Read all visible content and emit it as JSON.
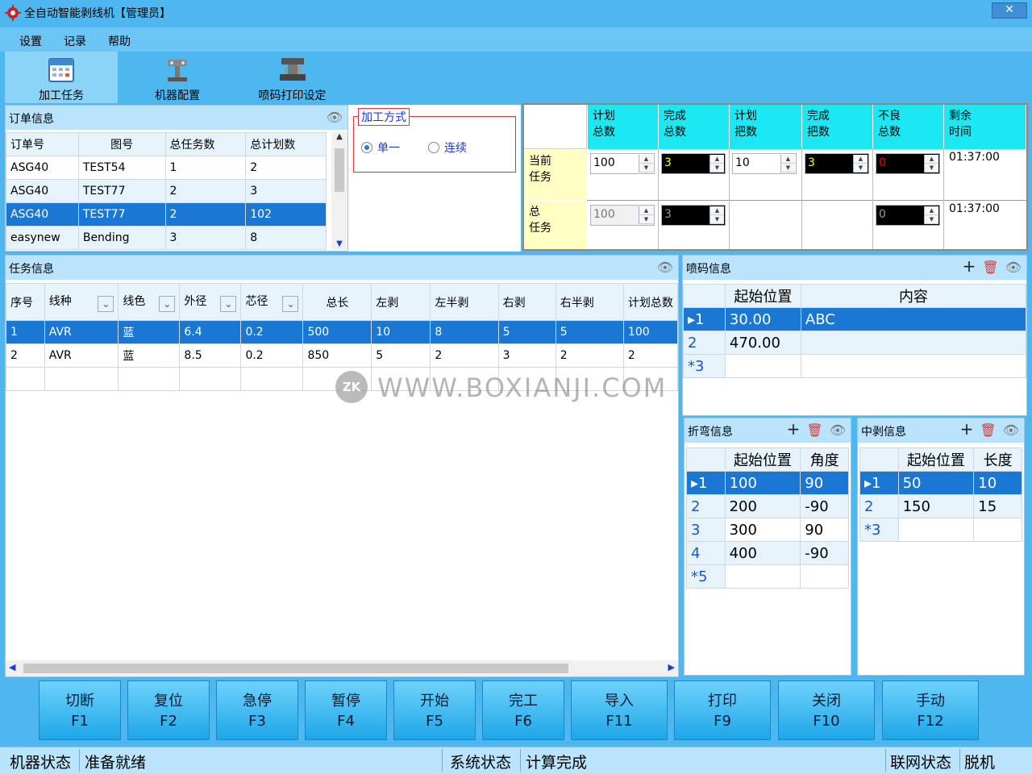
{
  "window": {
    "title": "全自动智能剥线机【管理员】",
    "close": "✕"
  },
  "menu": [
    "设置",
    "记录",
    "帮助"
  ],
  "toolbar": [
    {
      "label": "加工任务",
      "icon": "calendar-icon"
    },
    {
      "label": "机器配置",
      "icon": "robot-arm-icon"
    },
    {
      "label": "喷码打印设定",
      "icon": "printer-machine-icon"
    }
  ],
  "orders": {
    "title": "订单信息",
    "columns": [
      "订单号",
      "图号",
      "总任务数",
      "总计划数"
    ],
    "rows": [
      [
        "ASG40",
        "TEST54",
        "1",
        "2"
      ],
      [
        "ASG40",
        "TEST77",
        "2",
        "3"
      ],
      [
        "ASG40",
        "TEST77",
        "2",
        "102"
      ],
      [
        "easynew",
        "Bending",
        "3",
        "8"
      ]
    ],
    "selected_row": 2
  },
  "mode": {
    "title": "加工方式",
    "options": [
      "单一",
      "连续"
    ],
    "selected": "单一"
  },
  "stats": {
    "headers": [
      "计划\n总数",
      "完成\n总数",
      "计划\n把数",
      "完成\n把数",
      "不良\n总数",
      "剩余\n时间"
    ],
    "row_labels": [
      "当前\n任务",
      "总\n任务"
    ],
    "current": {
      "plan_total": "100",
      "done_total": "3",
      "plan_bundle": "10",
      "done_bundle": "3",
      "bad_total": "0",
      "remaining": "01:37:00"
    },
    "total": {
      "plan_total": "100",
      "done_total": "3",
      "bad_total": "0",
      "remaining": "01:37:00"
    }
  },
  "tasks": {
    "title": "任务信息",
    "columns": [
      "序号",
      "线种",
      "线色",
      "外径",
      "芯径",
      "总长",
      "左剥",
      "左半剥",
      "右剥",
      "右半剥",
      "计划总数"
    ],
    "rows": [
      [
        "1",
        "AVR",
        "蓝",
        "6.4",
        "0.2",
        "500",
        "10",
        "8",
        "5",
        "5",
        "100"
      ],
      [
        "2",
        "AVR",
        "蓝",
        "8.5",
        "0.2",
        "850",
        "5",
        "2",
        "3",
        "2",
        "2"
      ]
    ]
  },
  "spray": {
    "title": "喷码信息",
    "columns": [
      "起始位置",
      "内容"
    ],
    "rows": [
      {
        "n": "1",
        "pos": "30.00",
        "content": "ABC"
      },
      {
        "n": "2",
        "pos": "470.00",
        "content": ""
      },
      {
        "n": "3",
        "pos": "",
        "content": ""
      }
    ]
  },
  "bend": {
    "title": "折弯信息",
    "columns": [
      "起始位置",
      "角度"
    ],
    "rows": [
      {
        "n": "1",
        "pos": "100",
        "val": "90"
      },
      {
        "n": "2",
        "pos": "200",
        "val": "-90"
      },
      {
        "n": "3",
        "pos": "300",
        "val": "90"
      },
      {
        "n": "4",
        "pos": "400",
        "val": "-90"
      },
      {
        "n": "5",
        "pos": "",
        "val": ""
      }
    ]
  },
  "mid": {
    "title": "中剥信息",
    "columns": [
      "起始位置",
      "长度"
    ],
    "rows": [
      {
        "n": "1",
        "pos": "50",
        "val": "10"
      },
      {
        "n": "2",
        "pos": "150",
        "val": "15"
      },
      {
        "n": "3",
        "pos": "",
        "val": ""
      }
    ]
  },
  "fkeys": [
    {
      "label": "切断",
      "key": "F1"
    },
    {
      "label": "复位",
      "key": "F2"
    },
    {
      "label": "急停",
      "key": "F3"
    },
    {
      "label": "暂停",
      "key": "F4"
    },
    {
      "label": "开始",
      "key": "F5"
    },
    {
      "label": "完工",
      "key": "F6"
    },
    {
      "label": "导入",
      "key": "F11"
    },
    {
      "label": "打印",
      "key": "F9"
    },
    {
      "label": "关闭",
      "key": "F10"
    },
    {
      "label": "手动",
      "key": "F12"
    }
  ],
  "status": {
    "machine_label": "机器状态",
    "machine_value": "准备就绪",
    "system_label": "系统状态",
    "system_value": "计算完成",
    "network_label": "联网状态",
    "network_value": "脱机"
  },
  "watermark": {
    "logo": "ZK",
    "text": "WWW.BOXIANJI.COM"
  }
}
